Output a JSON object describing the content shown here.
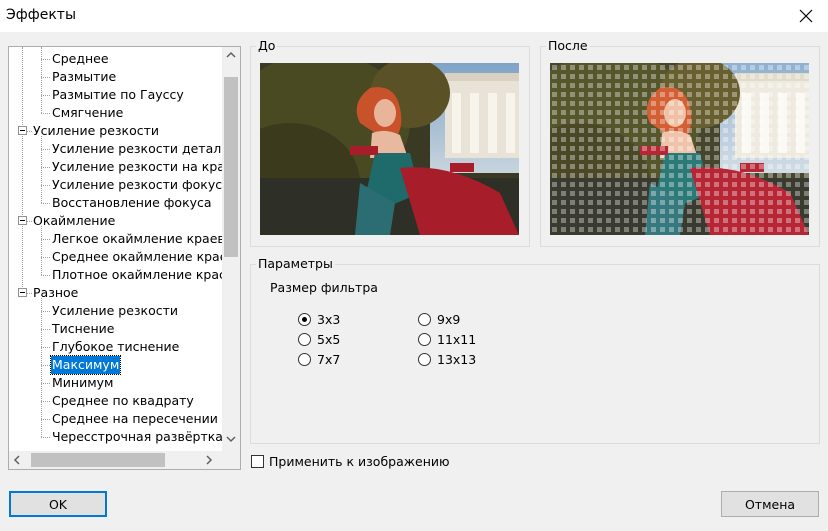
{
  "window": {
    "title": "Эффекты"
  },
  "tree": {
    "items": [
      {
        "label": "Среднее",
        "level": 1
      },
      {
        "label": "Размытие",
        "level": 1
      },
      {
        "label": "Размытие по Гауссу",
        "level": 1
      },
      {
        "label": "Смягчение",
        "level": 1
      },
      {
        "label": "Усиление резкости",
        "level": 0
      },
      {
        "label": "Усиление резкости детал",
        "level": 1
      },
      {
        "label": "Усиление резкости на кра",
        "level": 1
      },
      {
        "label": "Усиление резкости фокус",
        "level": 1
      },
      {
        "label": "Восстановление фокуса",
        "level": 1
      },
      {
        "label": "Окаймление",
        "level": 0
      },
      {
        "label": "Легкое окаймление краев",
        "level": 1
      },
      {
        "label": "Среднее окаймление крае",
        "level": 1
      },
      {
        "label": "Плотное окаймление крас",
        "level": 1
      },
      {
        "label": "Разное",
        "level": 0
      },
      {
        "label": "Усиление резкости",
        "level": 1
      },
      {
        "label": "Тиснение",
        "level": 1
      },
      {
        "label": "Глубокое тиснение",
        "level": 1
      },
      {
        "label": "Максимум",
        "level": 1,
        "selected": true
      },
      {
        "label": "Минимум",
        "level": 1
      },
      {
        "label": "Среднее по квадрату",
        "level": 1
      },
      {
        "label": "Среднее на пересечении",
        "level": 1
      },
      {
        "label": "Чересстрочная развёртка",
        "level": 1
      }
    ]
  },
  "before": {
    "label": "До"
  },
  "after": {
    "label": "После"
  },
  "params": {
    "group_label": "Параметры",
    "filter_size_label": "Размер фильтра",
    "options": [
      {
        "label": "3x3",
        "checked": true
      },
      {
        "label": "5x5",
        "checked": false
      },
      {
        "label": "7x7",
        "checked": false
      },
      {
        "label": "9x9",
        "checked": false
      },
      {
        "label": "11x11",
        "checked": false
      },
      {
        "label": "13x13",
        "checked": false
      }
    ]
  },
  "apply_to_image": {
    "label": "Применить к изображению",
    "checked": false
  },
  "buttons": {
    "ok": "OK",
    "cancel": "Отмена"
  }
}
